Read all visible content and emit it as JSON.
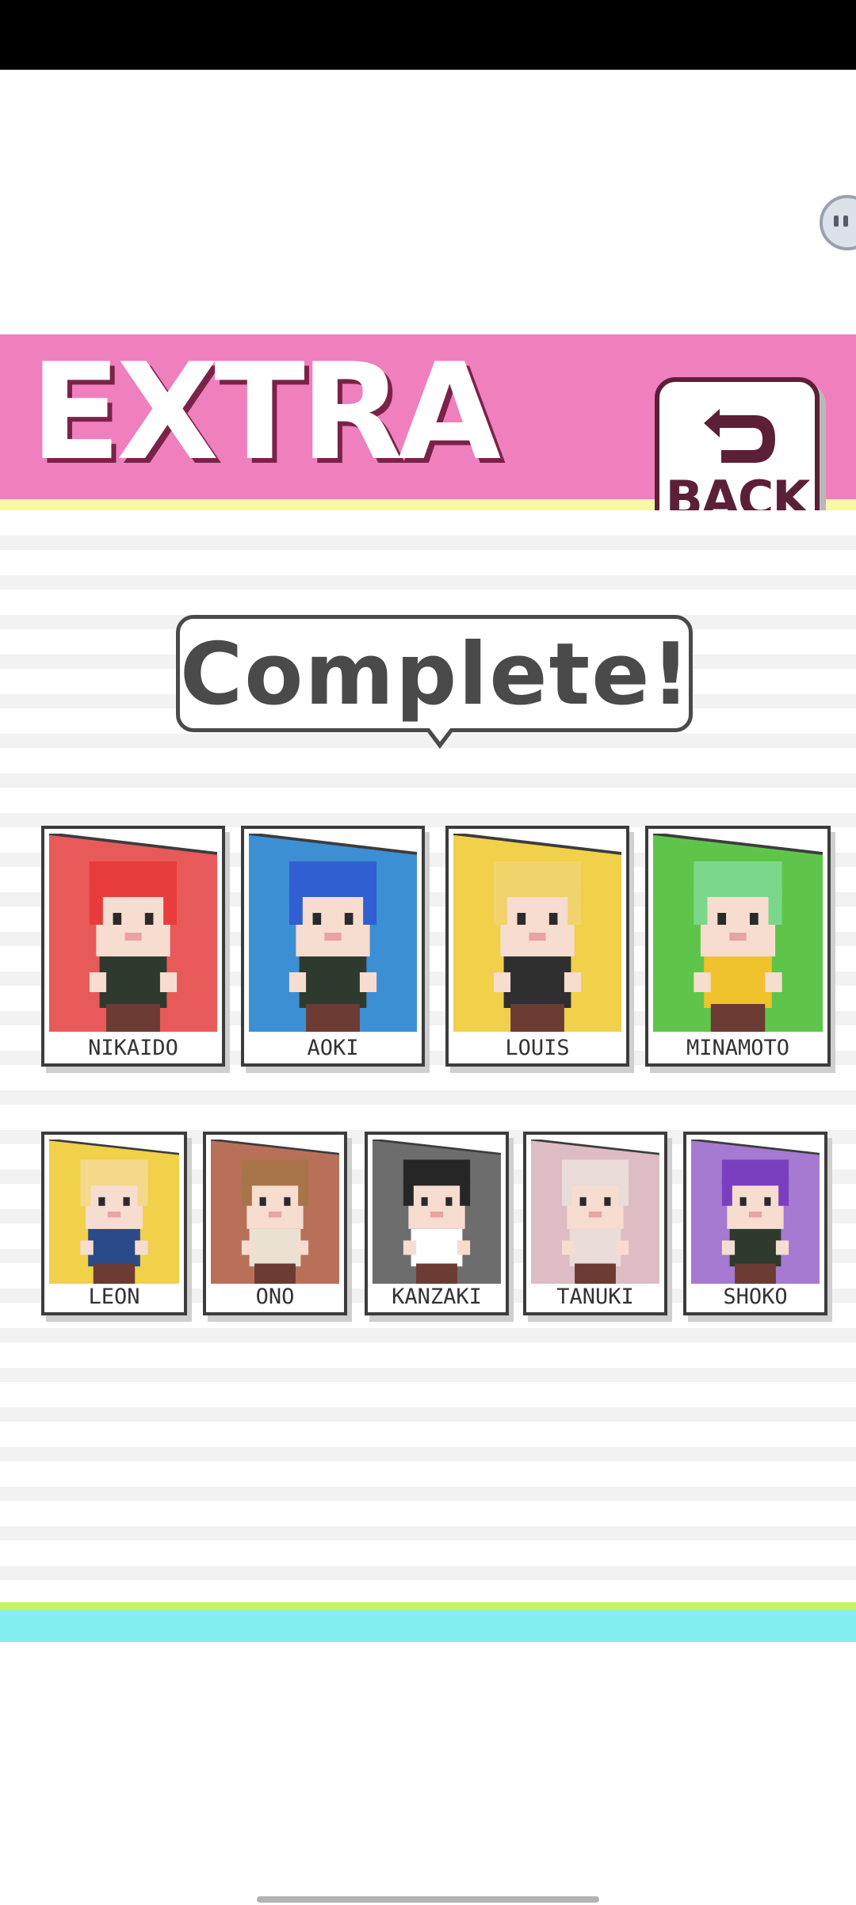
{
  "header": {
    "title": "EXTRA",
    "back_label": "BACK"
  },
  "banner": {
    "text": "Complete!"
  },
  "colors": {
    "header_pink": "#f07fbd",
    "header_yellow_line": "#fbf7a6",
    "bottom_green_line": "#c6f25c",
    "bottom_cyan": "#84eff0"
  },
  "characters": [
    {
      "name": "NIKAIDO",
      "color": "#e85a5a",
      "hair": "#e83c3c",
      "shirt": "#2f3a2e"
    },
    {
      "name": "AOKI",
      "color": "#3d8fd4",
      "hair": "#2f5fd0",
      "shirt": "#2f3a2e"
    },
    {
      "name": "LOUIS",
      "color": "#f1d04a",
      "hair": "#f2d36b",
      "shirt": "#2f2f2f"
    },
    {
      "name": "MINAMOTO",
      "color": "#5fc54a",
      "hair": "#7bd88a",
      "shirt": "#f0c22c"
    },
    {
      "name": "LEON",
      "color": "#f1d04a",
      "hair": "#f4d98a",
      "shirt": "#2b4a8a"
    },
    {
      "name": "ONO",
      "color": "#b87158",
      "hair": "#a8744a",
      "shirt": "#e9e2d2"
    },
    {
      "name": "KANZAKI",
      "color": "#6d6d6d",
      "hair": "#262626",
      "shirt": "#ffffff"
    },
    {
      "name": "TANUKI",
      "color": "#ddbcc3",
      "hair": "#eadcd8",
      "shirt": "#eadcd8"
    },
    {
      "name": "SHOKO",
      "color": "#a57ad0",
      "hair": "#7a3fbf",
      "shirt": "#2f3a2e"
    }
  ]
}
